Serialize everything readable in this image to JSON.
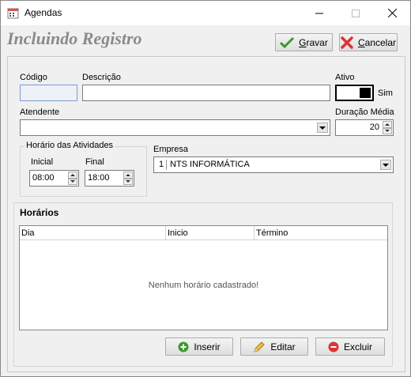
{
  "window": {
    "title": "Agendas"
  },
  "header": {
    "title": "Incluindo Registro"
  },
  "toolbar": {
    "save_label_u": "G",
    "save_label_rest": "ravar",
    "cancel_label_u": "C",
    "cancel_label_rest": "ancelar"
  },
  "form": {
    "codigo_label": "Código",
    "codigo_value": "",
    "descricao_label": "Descrição",
    "descricao_value": "",
    "ativo_label": "Ativo",
    "ativo_text": "Sim",
    "atendente_label": "Atendente",
    "atendente_value": "",
    "duracao_label": "Duração Média",
    "duracao_value": "20",
    "group_title": "Horário das Atividades",
    "inicial_label": "Inicial",
    "inicial_value": "08:00",
    "final_label": "Final",
    "final_value": "18:00",
    "empresa_label": "Empresa",
    "empresa_code": "1",
    "empresa_name": "NTS INFORMÁTICA"
  },
  "horarios": {
    "title": "Horários",
    "columns": [
      "Dia",
      "Inicio",
      "Término"
    ],
    "rows": [],
    "empty_message": "Nenhum horário cadastrado!",
    "insert_label": "Inserir",
    "edit_label": "Editar",
    "delete_label": "Excluir"
  },
  "colors": {
    "accent_green": "#3c9a2f",
    "cancel_red": "#d33",
    "title_gray": "#8a8a8a"
  }
}
